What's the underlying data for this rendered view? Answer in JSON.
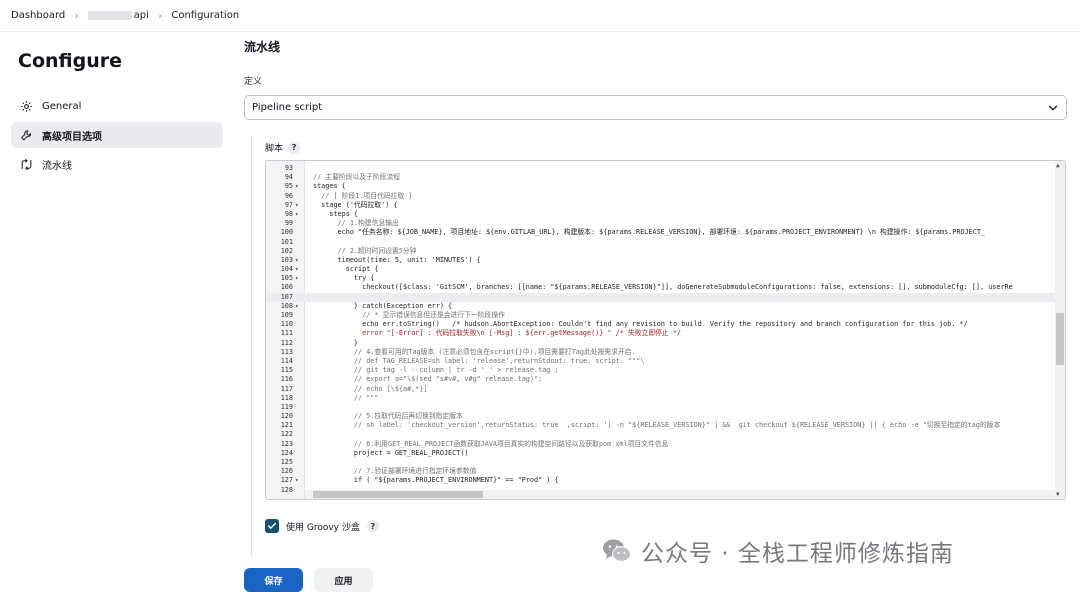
{
  "breadcrumb": {
    "item1": "Dashboard",
    "item2": "api",
    "item3": "Configuration",
    "sep": "›"
  },
  "sidebar": {
    "title": "Configure",
    "items": [
      {
        "label": "General",
        "icon": "gear-icon"
      },
      {
        "label": "高级项目选项",
        "icon": "wrench-icon"
      },
      {
        "label": "流水线",
        "icon": "pipeline-icon"
      }
    ]
  },
  "main": {
    "section_title": "流水线",
    "definition_label": "定义",
    "definition_value": "Pipeline script",
    "script_label": "脚本",
    "help": "?",
    "groovy_label": "使用 Groovy 沙盒",
    "groovy_checked": true,
    "save_label": "保存",
    "apply_label": "应用"
  },
  "editor": {
    "highlight_line": 107,
    "lines": [
      {
        "n": "93",
        "f": "",
        "c": ""
      },
      {
        "n": "94",
        "f": "",
        "c": "// 主要阶段以及子阶段流程",
        "t": "com"
      },
      {
        "n": "95",
        "f": "▾",
        "c": "stages {"
      },
      {
        "n": "96",
        "f": "",
        "c": "  // [ 阶段1.项目代码拉取 ]",
        "t": "com"
      },
      {
        "n": "97",
        "f": "▾",
        "c": "  stage ('代码拉取') {"
      },
      {
        "n": "98",
        "f": "▾",
        "c": "    steps {"
      },
      {
        "n": "99",
        "f": "",
        "c": "      // 1.构建信息输出",
        "t": "com"
      },
      {
        "n": "100",
        "f": "",
        "c": "      echo \"任务名称: ${JOB_NAME}, 项目地址: ${env.GITLAB_URL}, 构建版本: ${params.RELEASE_VERSION}, 部署环境: ${params.PROJECT_ENVIRONMENT} \\n 构建操作: ${params.PROJECT_"
      },
      {
        "n": "101",
        "f": "",
        "c": ""
      },
      {
        "n": "102",
        "f": "",
        "c": "      // 2.超时时间设置5分钟",
        "t": "com"
      },
      {
        "n": "103",
        "f": "▾",
        "c": "      timeout(time: 5, unit: 'MINUTES') {"
      },
      {
        "n": "104",
        "f": "▾",
        "c": "        script {"
      },
      {
        "n": "105",
        "f": "▾",
        "c": "          try {"
      },
      {
        "n": "106",
        "f": "",
        "c": "            checkout([$class: 'GitSCM', branches: [[name: \"${params.RELEASE_VERSION}\"]], doGenerateSubmoduleConfigurations: false, extensions: [], submoduleCfg: [], userRe"
      },
      {
        "n": "107",
        "f": "",
        "c": ""
      },
      {
        "n": "108",
        "f": "▾",
        "c": "          } catch(Exception err) {"
      },
      {
        "n": "109",
        "f": "",
        "c": "            // * 显示错误信息但还是会进行下一阶段操作",
        "t": "com"
      },
      {
        "n": "110",
        "f": "",
        "c": "            echo err.toString()   /* hudson.AbortException: Couldn't find any revision to build. Verify the repository and branch configuration for this job. */"
      },
      {
        "n": "111",
        "f": "",
        "c": "            error \"[-Error] : 代码拉取失败\\n [-Msg] : ${err.getMessage()} \" /* 失败立即停止 */",
        "t": "err"
      },
      {
        "n": "112",
        "f": "",
        "c": "          }"
      },
      {
        "n": "113",
        "f": "",
        "c": "          // 4.查看可用的Tag版本 (注意必须包含在script{}中),项目需要打Tag此处按需求开启.",
        "t": "com"
      },
      {
        "n": "114",
        "f": "",
        "c": "          // def TAG_RELEASE=sh label: 'release',returnStdout: true, script: \"\"\"\\",
        "t": "com"
      },
      {
        "n": "115",
        "f": "",
        "c": "          // git tag -l --column | tr -d ' ' > release.tag ;",
        "t": "com"
      },
      {
        "n": "116",
        "f": "",
        "c": "          // export a=\"\\$(sed \"s#v#, v#g\" release.tag)\";",
        "t": "com"
      },
      {
        "n": "117",
        "f": "",
        "c": "          // echo [\\${a#,*}]",
        "t": "com"
      },
      {
        "n": "118",
        "f": "",
        "c": "          // \"\"\"",
        "t": "com"
      },
      {
        "n": "119",
        "f": "",
        "c": ""
      },
      {
        "n": "120",
        "f": "",
        "c": "          // 5.拉取代码后再切换到指定版本",
        "t": "com"
      },
      {
        "n": "121",
        "f": "",
        "c": "          // sh label: 'checkout_version',returnStatus: true  ,script: '[ -n \"${RELEASE_VERSION}\" ] &&  git checkout ${RELEASE_VERSION} || { echo -e \"切换至指定的tag的版本",
        "t": "com"
      },
      {
        "n": "122",
        "f": "",
        "c": ""
      },
      {
        "n": "123",
        "f": "",
        "c": "          // 6.利用GET_REAL_PROJECT函数获取JAVA项目真实的构建空间路径以及获取pom.xml项目文件信息",
        "t": "com"
      },
      {
        "n": "124",
        "f": "",
        "c": "          project = GET_REAL_PROJECT()"
      },
      {
        "n": "125",
        "f": "",
        "c": ""
      },
      {
        "n": "126",
        "f": "",
        "c": "          // 7.验证部署环境进行指定环境参数值",
        "t": "com"
      },
      {
        "n": "127",
        "f": "▾",
        "c": "          if ( \"${params.PROJECT_ENVIRONMENT}\" == \"Prod\" ) {"
      },
      {
        "n": "128",
        "f": "",
        "c": ""
      }
    ]
  },
  "watermark": {
    "text": "公众号 · 全栈工程师修炼指南",
    "icon": "wechat-icon"
  }
}
